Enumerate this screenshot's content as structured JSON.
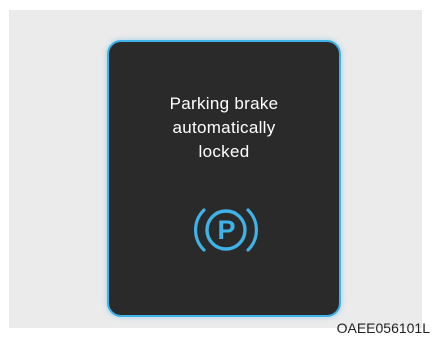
{
  "display": {
    "message_lines": [
      "Parking brake",
      "automatically",
      "locked"
    ],
    "icon": "parking-brake-icon",
    "icon_letter": "P",
    "accent_color": "#3fb2e8",
    "panel_color": "#2a2a2a"
  },
  "caption": "OAEE056101L"
}
